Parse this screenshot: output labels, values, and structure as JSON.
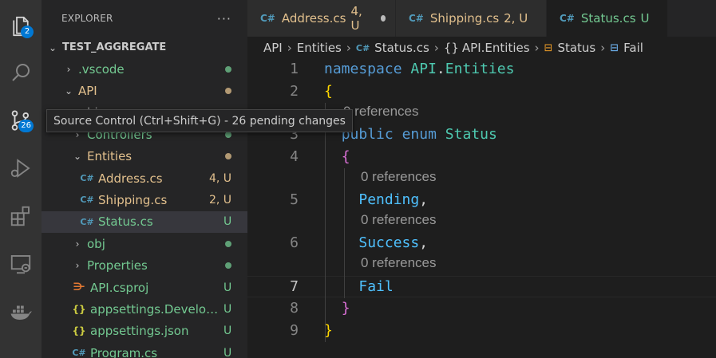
{
  "activity_bar": {
    "items": [
      {
        "icon": "files-icon",
        "badge": "2"
      },
      {
        "icon": "search-icon",
        "badge": ""
      },
      {
        "icon": "source-control-icon",
        "badge": "26"
      },
      {
        "icon": "run-debug-icon",
        "badge": ""
      },
      {
        "icon": "extensions-icon",
        "badge": ""
      },
      {
        "icon": "remote-explorer-icon",
        "badge": ""
      },
      {
        "icon": "docker-icon",
        "badge": ""
      }
    ]
  },
  "tooltip": "Source Control (Ctrl+Shift+G) - 26 pending changes",
  "sidebar": {
    "title": "EXPLORER",
    "more": "···",
    "root": "TEST_AGGREGATE",
    "tree": [
      {
        "label": ".vscode",
        "deco": "dot",
        "deco_color": "#73c991",
        "color": "#73c991",
        "kind": "folder"
      },
      {
        "label": "API",
        "deco": "dot",
        "deco_color": "#e2c08d",
        "color": "#e2c08d",
        "kind": "folder"
      },
      {
        "label": "bin",
        "deco": "",
        "color": "#8c8c8c",
        "kind": "folder"
      },
      {
        "label": "Controllers",
        "deco": "dot",
        "deco_color": "#73c991",
        "color": "#73c991",
        "kind": "folder"
      },
      {
        "label": "Entities",
        "deco": "dot",
        "deco_color": "#e2c08d",
        "color": "#e2c08d",
        "kind": "folder"
      },
      {
        "label": "Address.cs",
        "deco": "4, U",
        "color": "#e2c08d",
        "kind": "cs"
      },
      {
        "label": "Shipping.cs",
        "deco": "2, U",
        "color": "#e2c08d",
        "kind": "cs"
      },
      {
        "label": "Status.cs",
        "deco": "U",
        "color": "#73c991",
        "kind": "cs"
      },
      {
        "label": "obj",
        "deco": "dot",
        "deco_color": "#73c991",
        "color": "#73c991",
        "kind": "folder"
      },
      {
        "label": "Properties",
        "deco": "dot",
        "deco_color": "#73c991",
        "color": "#73c991",
        "kind": "folder"
      },
      {
        "label": "API.csproj",
        "deco": "U",
        "color": "#73c991",
        "kind": "rss"
      },
      {
        "label": "appsettings.Develop...",
        "deco": "U",
        "color": "#73c991",
        "kind": "json"
      },
      {
        "label": "appsettings.json",
        "deco": "U",
        "color": "#73c991",
        "kind": "json"
      },
      {
        "label": "Program.cs",
        "deco": "U",
        "color": "#73c991",
        "kind": "cs"
      }
    ]
  },
  "tabs": [
    {
      "name": "Address.cs",
      "mod": "4, U",
      "color": "#e2c08d",
      "dirty": true,
      "active": false
    },
    {
      "name": "Shipping.cs",
      "mod": "2, U",
      "color": "#e2c08d",
      "dirty": false,
      "active": false
    },
    {
      "name": "Status.cs",
      "mod": "U",
      "color": "#73c991",
      "dirty": true,
      "active": true
    }
  ],
  "breadcrumb": {
    "items": [
      "API",
      "Entities",
      "Status.cs",
      "API.Entities",
      "Status",
      "Fail"
    ],
    "cs_glyph": "C#",
    "namespace_glyph": "{}"
  },
  "editor": {
    "codelens": "0 references",
    "lines": [
      {
        "num": "1",
        "tokens": [
          [
            "kw",
            "namespace"
          ],
          [
            "pl",
            " "
          ],
          [
            "ns",
            "API"
          ],
          [
            "pl",
            "."
          ],
          [
            "ns",
            "Entities"
          ]
        ]
      },
      {
        "num": "2",
        "tokens": [
          [
            "p1",
            "{"
          ]
        ]
      },
      {
        "num": "3",
        "tokens": [
          [
            "pl",
            "  "
          ],
          [
            "kw",
            "public"
          ],
          [
            "pl",
            " "
          ],
          [
            "kw",
            "enum"
          ],
          [
            "pl",
            " "
          ],
          [
            "ty",
            "Status"
          ]
        ]
      },
      {
        "num": "4",
        "tokens": [
          [
            "pl",
            "  "
          ],
          [
            "p2",
            "{"
          ]
        ]
      },
      {
        "num": "5",
        "tokens": [
          [
            "pl",
            "    "
          ],
          [
            "mb",
            "Pending"
          ],
          [
            "pl",
            ","
          ]
        ]
      },
      {
        "num": "6",
        "tokens": [
          [
            "pl",
            "    "
          ],
          [
            "mb",
            "Success"
          ],
          [
            "pl",
            ","
          ]
        ]
      },
      {
        "num": "7",
        "tokens": [
          [
            "pl",
            "    "
          ],
          [
            "mb",
            "Fail"
          ]
        ]
      },
      {
        "num": "8",
        "tokens": [
          [
            "pl",
            "  "
          ],
          [
            "p2",
            "}"
          ]
        ]
      },
      {
        "num": "9",
        "tokens": [
          [
            "p1",
            "}"
          ]
        ]
      }
    ],
    "current_line": "7"
  }
}
